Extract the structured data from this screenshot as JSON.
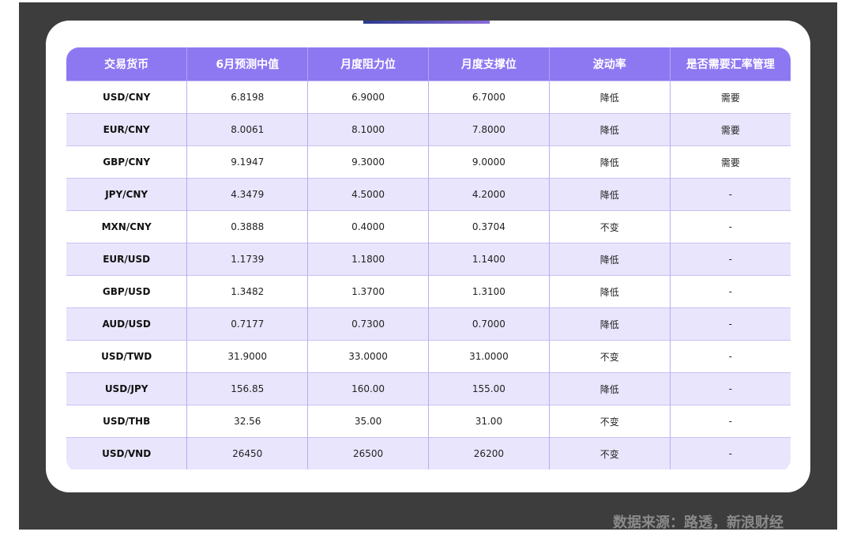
{
  "table": {
    "headers": [
      "交易货币",
      "6月预测中值",
      "月度阻力位",
      "月度支撑位",
      "波动率",
      "是否需要汇率管理"
    ],
    "rows": [
      [
        "USD/CNY",
        "6.8198",
        "6.9000",
        "6.7000",
        "降低",
        "需要"
      ],
      [
        "EUR/CNY",
        "8.0061",
        "8.1000",
        "7.8000",
        "降低",
        "需要"
      ],
      [
        "GBP/CNY",
        "9.1947",
        "9.3000",
        "9.0000",
        "降低",
        "需要"
      ],
      [
        "JPY/CNY",
        "4.3479",
        "4.5000",
        "4.2000",
        "降低",
        "-"
      ],
      [
        "MXN/CNY",
        "0.3888",
        "0.4000",
        "0.3704",
        "不变",
        "-"
      ],
      [
        "EUR/USD",
        "1.1739",
        "1.1800",
        "1.1400",
        "降低",
        "-"
      ],
      [
        "GBP/USD",
        "1.3482",
        "1.3700",
        "1.3100",
        "降低",
        "-"
      ],
      [
        "AUD/USD",
        "0.7177",
        "0.7300",
        "0.7000",
        "降低",
        "-"
      ],
      [
        "USD/TWD",
        "31.9000",
        "33.0000",
        "31.0000",
        "不变",
        "-"
      ],
      [
        "USD/JPY",
        "156.85",
        "160.00",
        "155.00",
        "降低",
        "-"
      ],
      [
        "USD/THB",
        "32.56",
        "35.00",
        "31.00",
        "不变",
        "-"
      ],
      [
        "USD/VND",
        "26450",
        "26500",
        "26200",
        "不变",
        "-"
      ]
    ]
  },
  "footer": {
    "source": "数据来源：路透，新浪财经"
  },
  "colors": {
    "header_bg": "#8e78f2",
    "alt_row_bg": "#e9e5fc",
    "panel_bg": "#3d3d3d"
  }
}
